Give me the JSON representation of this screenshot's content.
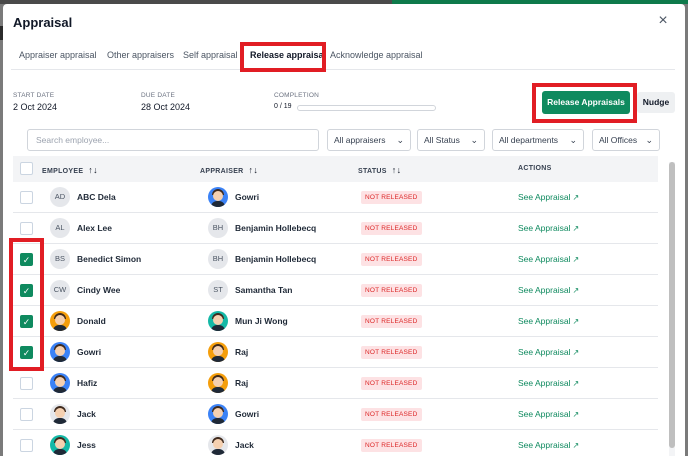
{
  "modal": {
    "title": "Appraisal",
    "close_symbol": "×"
  },
  "tabs": [
    {
      "label": "Appraiser appraisal"
    },
    {
      "label": "Other appraisers"
    },
    {
      "label": "Self appraisal"
    },
    {
      "label": "Release appraisal"
    },
    {
      "label": "Acknowledge appraisal"
    }
  ],
  "meta": {
    "start_date_label": "START DATE",
    "start_date": "2 Oct 2024",
    "due_date_label": "DUE DATE",
    "due_date": "28 Oct 2024",
    "completion_label": "COMPLETION",
    "completion_text": "0 / 19",
    "completion_progress": 0
  },
  "actions": {
    "release_button": "Release Appraisals",
    "nudge_button": "Nudge"
  },
  "filters": {
    "search_placeholder": "Search employee...",
    "appraisers": "All appraisers",
    "status": "All Status",
    "departments": "All departments",
    "offices": "All Offices"
  },
  "table": {
    "headers": {
      "employee": "EMPLOYEE",
      "appraiser": "APPRAISER",
      "status": "STATUS",
      "actions": "ACTIONS"
    },
    "sort_symbol": "↑↓",
    "rows": [
      {
        "initials": "AD",
        "employee": "ABC Dela",
        "appraiser_initials": "",
        "appraiser": "Gowri",
        "status": "NOT RELEASED",
        "action": "See Appraisal",
        "checked": false
      },
      {
        "initials": "AL",
        "employee": "Alex Lee",
        "appraiser_initials": "BH",
        "appraiser": "Benjamin Hollebecq",
        "status": "NOT RELEASED",
        "action": "See Appraisal",
        "checked": false
      },
      {
        "initials": "BS",
        "employee": "Benedict Simon",
        "appraiser_initials": "BH",
        "appraiser": "Benjamin Hollebecq",
        "status": "NOT RELEASED",
        "action": "See Appraisal",
        "checked": true
      },
      {
        "initials": "CW",
        "employee": "Cindy Wee",
        "appraiser_initials": "ST",
        "appraiser": "Samantha Tan",
        "status": "NOT RELEASED",
        "action": "See Appraisal",
        "checked": true
      },
      {
        "initials": "",
        "employee": "Donald",
        "appraiser_initials": "",
        "appraiser": "Mun Ji Wong",
        "status": "NOT RELEASED",
        "action": "See Appraisal",
        "checked": true
      },
      {
        "initials": "",
        "employee": "Gowri",
        "appraiser_initials": "",
        "appraiser": "Raj",
        "status": "NOT RELEASED",
        "action": "See Appraisal",
        "checked": true
      },
      {
        "initials": "",
        "employee": "Hafiz",
        "appraiser_initials": "",
        "appraiser": "Raj",
        "status": "NOT RELEASED",
        "action": "See Appraisal",
        "checked": false
      },
      {
        "initials": "",
        "employee": "Jack",
        "appraiser_initials": "",
        "appraiser": "Gowri",
        "status": "NOT RELEASED",
        "action": "See Appraisal",
        "checked": false
      },
      {
        "initials": "",
        "employee": "Jess",
        "appraiser_initials": "",
        "appraiser": "Jack",
        "status": "NOT RELEASED",
        "action": "See Appraisal",
        "checked": false
      }
    ]
  },
  "icons": {
    "check": "✓",
    "chevron": "⌄",
    "external": "↗"
  },
  "colors": {
    "accent": "#0f8a5f",
    "badge_bg": "#fde2e4",
    "badge_text": "#dc2626",
    "highlight": "#e11d24"
  }
}
